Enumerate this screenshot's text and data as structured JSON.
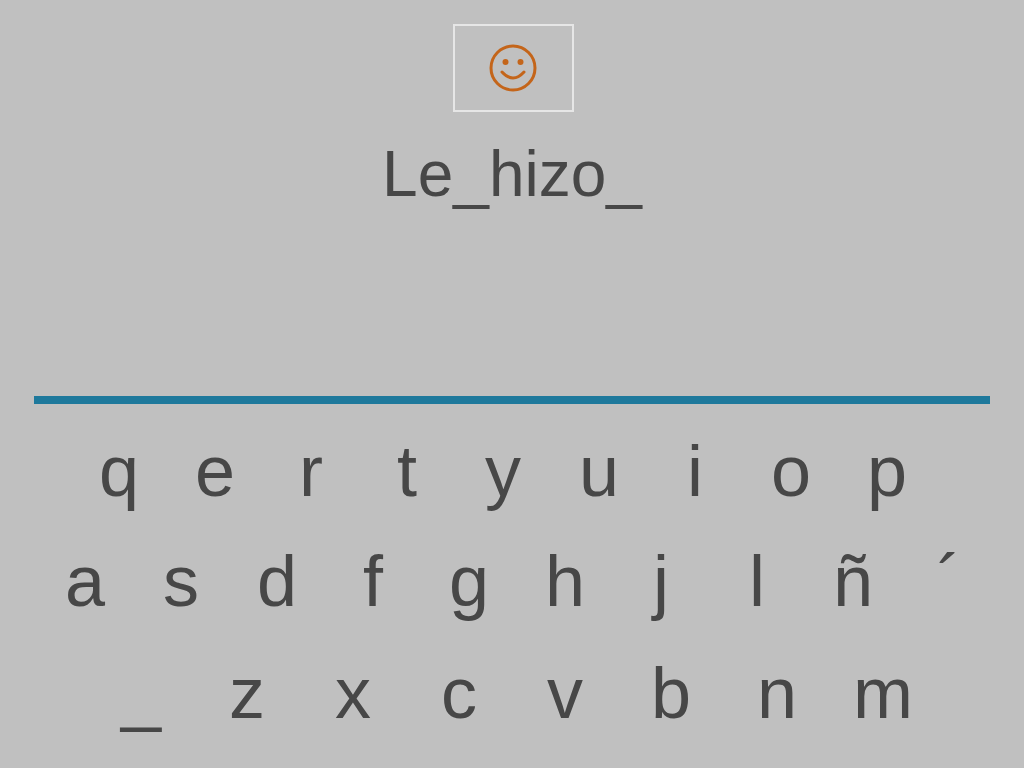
{
  "answer": "Le_hizo_",
  "keyboard": {
    "rows": [
      [
        "q",
        "e",
        "r",
        "t",
        "y",
        "u",
        "i",
        "o",
        "p"
      ],
      [
        "a",
        "s",
        "d",
        "f",
        "g",
        "h",
        "j",
        "l",
        "ñ",
        "´"
      ],
      [
        "_",
        "z",
        "x",
        "c",
        "v",
        "b",
        "n",
        "m"
      ]
    ]
  }
}
